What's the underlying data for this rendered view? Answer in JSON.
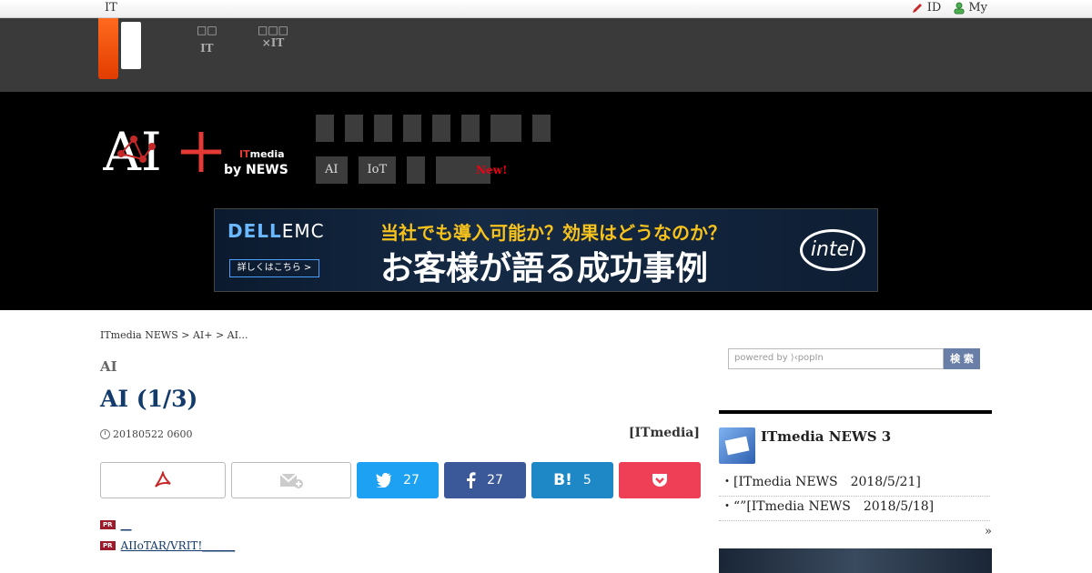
{
  "topbar": {
    "left_label": "IT",
    "id_label": "ID",
    "my_label": "My"
  },
  "band_nav": [
    {
      "line1": "□□",
      "line2": "IT"
    },
    {
      "line1": "□□□",
      "line2": "×IT"
    }
  ],
  "logo": {
    "ai_text": "AI+",
    "itmedia": "ITmedia",
    "by": "by NEWS"
  },
  "categories_row2": [
    {
      "label": "AI"
    },
    {
      "label": "IoT"
    },
    {
      "label": ""
    },
    {
      "label": ""
    }
  ],
  "new_badge": "New!",
  "banner": {
    "brand_dell": "DELL",
    "brand_emc": "EMC",
    "more": "詳しくはこちら >",
    "line1": "当社でも導入可能か？効果はどうなのか？",
    "line2": "お客様が語る成功事例",
    "intel": "intel"
  },
  "breadcrumb": "ITmedia NEWS > AI+ > AI...",
  "category": "AI",
  "title": "AI (1/3)",
  "date": "20180522 0600",
  "source": "[ITmedia]",
  "share": {
    "twitter": "27",
    "facebook": "27",
    "hatena": "5",
    "hatena_label": "B!"
  },
  "pr_links": [
    {
      "badge": "PR",
      "text": "__"
    },
    {
      "badge": "PR",
      "text": "AIIoTAR/VRIT!______"
    }
  ],
  "search": {
    "placeholder": "powered by ⟩‹popIn",
    "button": "検 索"
  },
  "sidebar": {
    "heading": "ITmedia NEWS 3",
    "items": [
      {
        "text": "・[ITmedia NEWS　2018/5/21]"
      },
      {
        "text": "・“”[ITmedia NEWS　2018/5/18]"
      }
    ],
    "more": "»"
  }
}
